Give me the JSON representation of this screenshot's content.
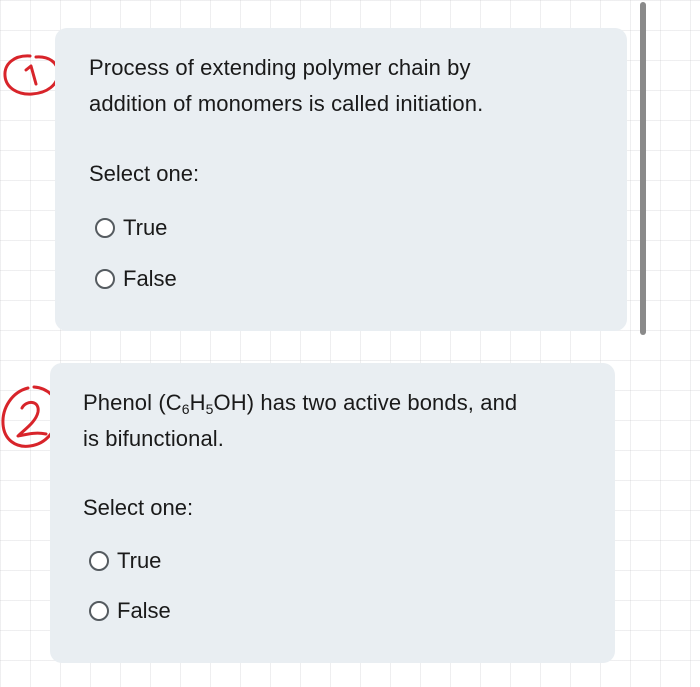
{
  "questions": [
    {
      "number_mark": "1",
      "text_line1": "Process of extending polymer chain by",
      "text_line2": "addition of monomers is called initiation.",
      "select_label": "Select one:",
      "options": [
        "True",
        "False"
      ]
    },
    {
      "number_mark": "2",
      "text_prefix": "Phenol (C",
      "sub1": "6",
      "mid": "H",
      "sub2": "5",
      "text_suffix": "OH) has two active bonds, and",
      "text_line2": "is bifunctional.",
      "select_label": "Select one:",
      "options": [
        "True",
        "False"
      ]
    }
  ],
  "colors": {
    "card_background": "#e9eef2",
    "annotation_ink": "#d8242a",
    "radio_border": "#555b60",
    "scrollbar": "#8a8a8a"
  },
  "icons": {
    "annotation_1": "handwritten-circled-1-icon",
    "annotation_2": "handwritten-circled-2-icon",
    "radio": "radio-unchecked-icon"
  }
}
